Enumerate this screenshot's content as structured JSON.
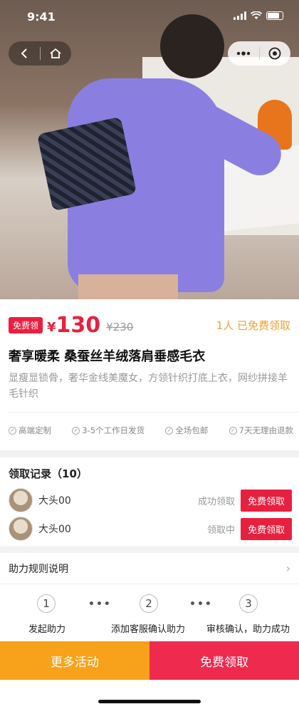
{
  "status_bar": {
    "time": "9:41"
  },
  "product": {
    "tag": "免费领",
    "currency": "¥",
    "price": "130",
    "original_price": "¥230",
    "claimed": "1人 已免费领取",
    "title": "奢享暖柔 桑蚕丝羊绒落肩垂感毛衣",
    "description": "显瘦显锁骨，奢华金线美魔女，方领针织打底上衣，网纱拼接羊毛针织",
    "guarantees": [
      "高端定制",
      "3-5个工作日发货",
      "全场包邮",
      "7天无理由退款"
    ]
  },
  "records": {
    "header": "领取记录（10）",
    "items": [
      {
        "name": "大头00",
        "status": "成功领取",
        "button": "免费领取"
      },
      {
        "name": "大头00",
        "status": "领取中",
        "button": "免费领取"
      }
    ]
  },
  "rules": {
    "title": "助力规则说明"
  },
  "steps": [
    {
      "num": "1",
      "label": "发起助力"
    },
    {
      "num": "2",
      "label": "添加客服确认助力"
    },
    {
      "num": "3",
      "label": "审核确认，助力成功"
    }
  ],
  "actions": {
    "more": "更多活动",
    "claim": "免费领取"
  },
  "colors": {
    "accent_red": "#e8203f",
    "accent_orange": "#f7a21a"
  }
}
